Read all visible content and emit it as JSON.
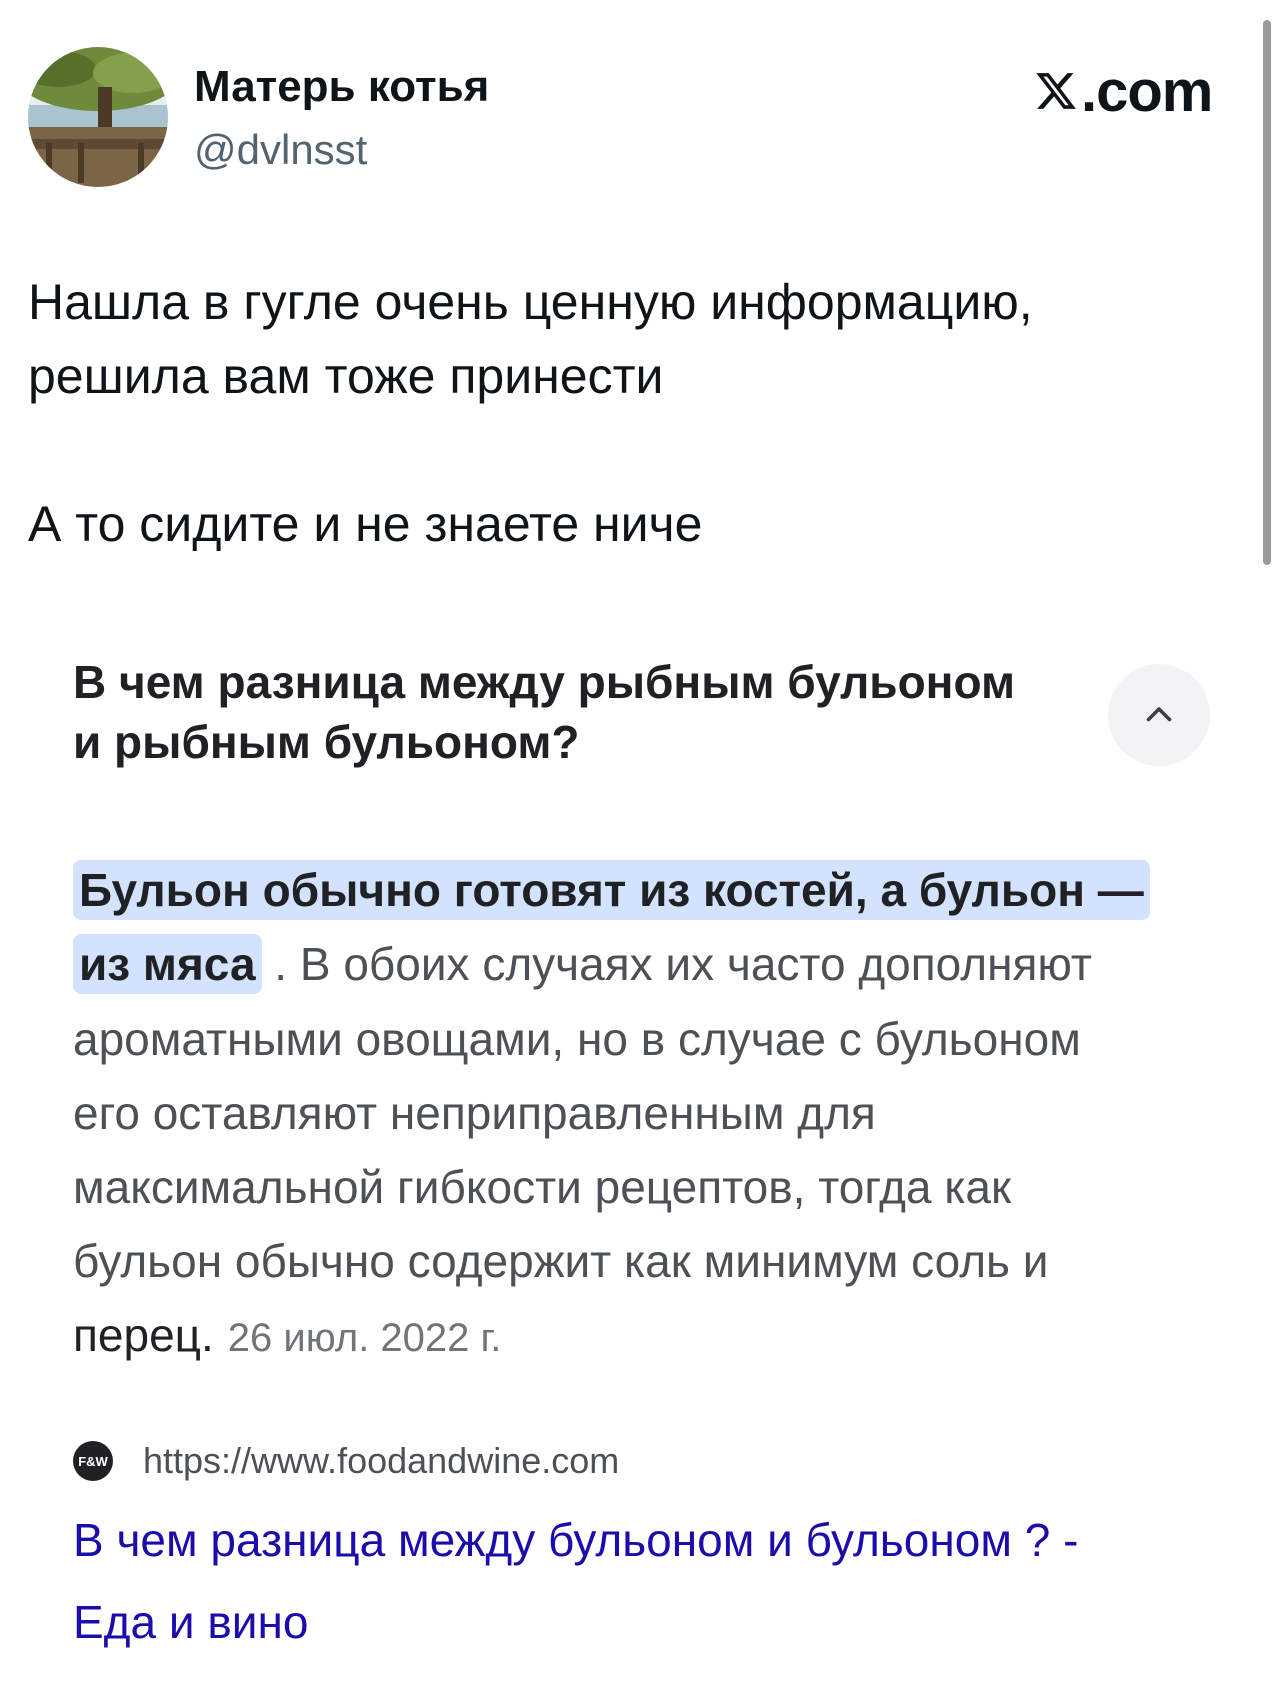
{
  "author": {
    "name": "Матерь котья",
    "handle": "@dvlnsst"
  },
  "site": {
    "domain": ".com",
    "logo_icon": "x-logo-icon"
  },
  "tweet": {
    "lines": [
      "Нашла в гугле очень ценную информацию,",
      "решила вам тоже принести",
      "А то сидите и не знаете ниче"
    ]
  },
  "snippet": {
    "question_lines": [
      "В чем разница между рыбным бульоном",
      "и рыбным бульоном?"
    ],
    "collapse_icon": "chevron-up-icon",
    "highlight_line_1": "Бульон обычно готовят из костей, а бульон —",
    "highlight_line_2": "из мяса",
    "answer_line_2_rest": " . В обоих случаях их часто дополняют",
    "answer_lines": [
      "ароматными овощами, но в случае с бульоном",
      "его оставляют неприправленным для",
      "максимальной гибкости рецептов, тогда как",
      "бульон обычно содержит как минимум соль и"
    ],
    "answer_last_word": "перец.",
    "date": "26 июл. 2022 г.",
    "source": {
      "favicon_text": "F&W",
      "url": "https://www.foodandwine.com"
    },
    "result_title_lines": [
      "В чем разница между бульоном и бульоном ? -",
      "Еда и вино"
    ]
  },
  "colors": {
    "highlight": "#d3e3fd",
    "link": "#1a0dab",
    "text_primary": "#0f1419",
    "text_secondary": "#536471"
  }
}
